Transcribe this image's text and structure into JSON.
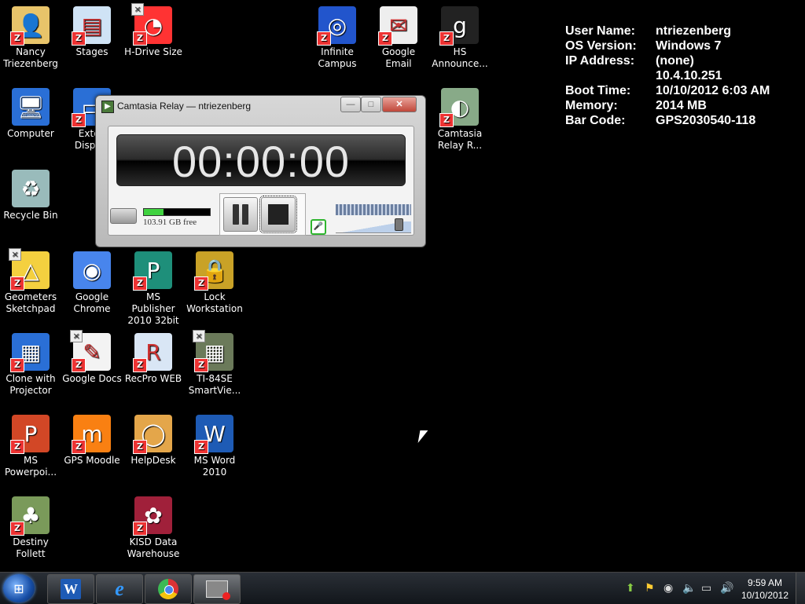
{
  "desktop_icons": [
    {
      "label": "Nancy Triezenberg",
      "icon": "user-folder-icon"
    },
    {
      "label": "Stages",
      "icon": "stages-icon"
    },
    {
      "label": "H-Drive Size",
      "icon": "pie-chart-icon"
    },
    {
      "label": "Infinite Campus",
      "icon": "infinite-campus-icon"
    },
    {
      "label": "Google Email",
      "icon": "gmail-icon"
    },
    {
      "label": "HS Announce...",
      "icon": "hs-announcements-icon"
    },
    {
      "label": "Computer",
      "icon": "computer-icon"
    },
    {
      "label": "Exten Display",
      "icon": "extend-display-icon"
    },
    {
      "label": "Camtasia Relay R...",
      "icon": "camtasia-relay-icon"
    },
    {
      "label": "Recycle Bin",
      "icon": "recycle-bin-icon"
    },
    {
      "label": "Geometers Sketchpad",
      "icon": "geometers-sketchpad-icon"
    },
    {
      "label": "Google Chrome",
      "icon": "chrome-icon"
    },
    {
      "label": "MS Publisher 2010 32bit",
      "icon": "publisher-icon"
    },
    {
      "label": "Lock Workstation",
      "icon": "lock-icon"
    },
    {
      "label": "Clone with Projector",
      "icon": "clone-display-icon"
    },
    {
      "label": "Google Docs",
      "icon": "google-docs-icon"
    },
    {
      "label": "RecPro WEB",
      "icon": "recpro-icon"
    },
    {
      "label": "TI-84SE SmartVie...",
      "icon": "calculator-icon"
    },
    {
      "label": "MS Powerpoi...",
      "icon": "powerpoint-icon"
    },
    {
      "label": "GPS Moodle",
      "icon": "moodle-icon"
    },
    {
      "label": "HelpDesk",
      "icon": "lifebuoy-icon"
    },
    {
      "label": "MS Word 2010",
      "icon": "word-icon"
    },
    {
      "label": "Destiny Follett",
      "icon": "tree-icon"
    },
    {
      "label": "KISD Data Warehouse",
      "icon": "data-warehouse-icon"
    }
  ],
  "sysinfo": {
    "user_name_label": "User Name:",
    "user_name": "ntriezenberg",
    "os_label": "OS Version:",
    "os": "Windows 7",
    "ip_label": "IP Address:",
    "ip1": "(none)",
    "ip2": "10.4.10.251",
    "boot_label": "Boot Time:",
    "boot": "10/10/2012 6:03 AM",
    "memory_label": "Memory:",
    "memory": "2014 MB",
    "barcode_label": "Bar Code:",
    "barcode": "GPS2030540-118"
  },
  "camtasia": {
    "title": "Camtasia Relay — ntriezenberg",
    "timer": "00:00:00",
    "free_space": "103.91 GB free",
    "free_space_fill_fraction": 0.3,
    "volume_fraction": 0.78,
    "minimize": "—",
    "maximize": "□",
    "close": "✕"
  },
  "taskbar": {
    "word_glyph": "W",
    "ie_glyph": "e",
    "time": "9:59 AM",
    "date": "10/10/2012"
  },
  "colors": {
    "desktop_bg": "#000000",
    "taskbar": "#1a1e24",
    "accent_green": "#3fd23f"
  }
}
